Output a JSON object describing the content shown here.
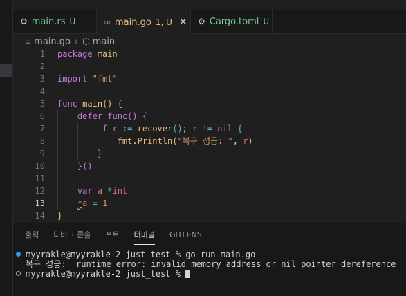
{
  "tabs": [
    {
      "icon": "rust-icon",
      "icon_glyph": "⚙",
      "label": "main.rs",
      "status": "U",
      "active": false
    },
    {
      "icon": "go-icon",
      "icon_glyph": "∞",
      "label": "main.go",
      "status": "1, U",
      "active": true,
      "close": "✕"
    },
    {
      "icon": "gear-icon",
      "icon_glyph": "⚙",
      "label": "Cargo.toml",
      "status": "U",
      "active": false
    }
  ],
  "breadcrumb": {
    "icon_glyph": "∞",
    "file": "main.go",
    "sep": "›",
    "symbol_glyph": "⬡",
    "symbol": "main"
  },
  "editor": {
    "current_line": 13,
    "lines": [
      {
        "n": "1",
        "t": [
          [
            "kw",
            "package"
          ],
          [
            "pl",
            " "
          ],
          [
            "fn",
            "main"
          ]
        ]
      },
      {
        "n": "2",
        "t": []
      },
      {
        "n": "3",
        "t": [
          [
            "kw",
            "import"
          ],
          [
            "pl",
            " "
          ],
          [
            "str",
            "\"fmt\""
          ]
        ]
      },
      {
        "n": "4",
        "t": []
      },
      {
        "n": "5",
        "t": [
          [
            "kw",
            "func"
          ],
          [
            "pl",
            " "
          ],
          [
            "fn",
            "main"
          ],
          [
            "br1",
            "()"
          ],
          [
            "pl",
            " "
          ],
          [
            "br1",
            "{"
          ]
        ]
      },
      {
        "n": "6",
        "t": [
          [
            "pl",
            "    "
          ],
          [
            "kw",
            "defer"
          ],
          [
            "pl",
            " "
          ],
          [
            "kw",
            "func"
          ],
          [
            "br2",
            "()"
          ],
          [
            "pl",
            " "
          ],
          [
            "br2",
            "{"
          ]
        ]
      },
      {
        "n": "7",
        "t": [
          [
            "pl",
            "        "
          ],
          [
            "kw",
            "if"
          ],
          [
            "pl",
            " "
          ],
          [
            "id",
            "r"
          ],
          [
            "pl",
            " "
          ],
          [
            "op",
            ":="
          ],
          [
            "pl",
            " "
          ],
          [
            "fn",
            "recover"
          ],
          [
            "br3",
            "()"
          ],
          [
            "pl",
            "; "
          ],
          [
            "id",
            "r"
          ],
          [
            "pl",
            " "
          ],
          [
            "op",
            "!="
          ],
          [
            "pl",
            " "
          ],
          [
            "kw",
            "nil"
          ],
          [
            "pl",
            " "
          ],
          [
            "br3",
            "{"
          ]
        ]
      },
      {
        "n": "8",
        "t": [
          [
            "pl",
            "            "
          ],
          [
            "fn",
            "fmt"
          ],
          [
            "pl",
            "."
          ],
          [
            "fn",
            "Println"
          ],
          [
            "br1",
            "("
          ],
          [
            "str",
            "\"복구 성공: \""
          ],
          [
            "pl",
            ", "
          ],
          [
            "id",
            "r"
          ],
          [
            "br1",
            ")"
          ]
        ]
      },
      {
        "n": "9",
        "t": [
          [
            "pl",
            "        "
          ],
          [
            "br3",
            "}"
          ]
        ]
      },
      {
        "n": "10",
        "t": [
          [
            "pl",
            "    "
          ],
          [
            "br2",
            "}()"
          ]
        ]
      },
      {
        "n": "11",
        "t": []
      },
      {
        "n": "12",
        "t": [
          [
            "pl",
            "    "
          ],
          [
            "kw",
            "var"
          ],
          [
            "pl",
            " "
          ],
          [
            "id",
            "a"
          ],
          [
            "pl",
            " "
          ],
          [
            "op",
            "*"
          ],
          [
            "ty",
            "int"
          ]
        ]
      },
      {
        "n": "13",
        "t": [
          [
            "pl",
            "    "
          ],
          [
            "op",
            "*"
          ],
          [
            "id",
            "a"
          ],
          [
            "pl",
            " "
          ],
          [
            "op",
            "="
          ],
          [
            "pl",
            " "
          ],
          [
            "str",
            "1"
          ]
        ]
      },
      {
        "n": "14",
        "t": [
          [
            "br1",
            "}"
          ]
        ]
      }
    ]
  },
  "panel": {
    "tabs": [
      "출력",
      "디버그 콘솔",
      "포트",
      "터미널",
      "GITLENS"
    ],
    "active_tab": "터미널",
    "terminal": [
      {
        "marker": "filled",
        "text": "myyrakle@myyrakle-2 just_test % go run main.go"
      },
      {
        "marker": "none",
        "text": "복구 성공:  runtime error: invalid memory address or nil pointer dereference"
      },
      {
        "marker": "hollow",
        "text": "myyrakle@myyrakle-2 just_test % "
      }
    ]
  },
  "colors": {
    "accent": "#0078d4",
    "modified": "#e5c07b",
    "untracked": "#73c991"
  }
}
